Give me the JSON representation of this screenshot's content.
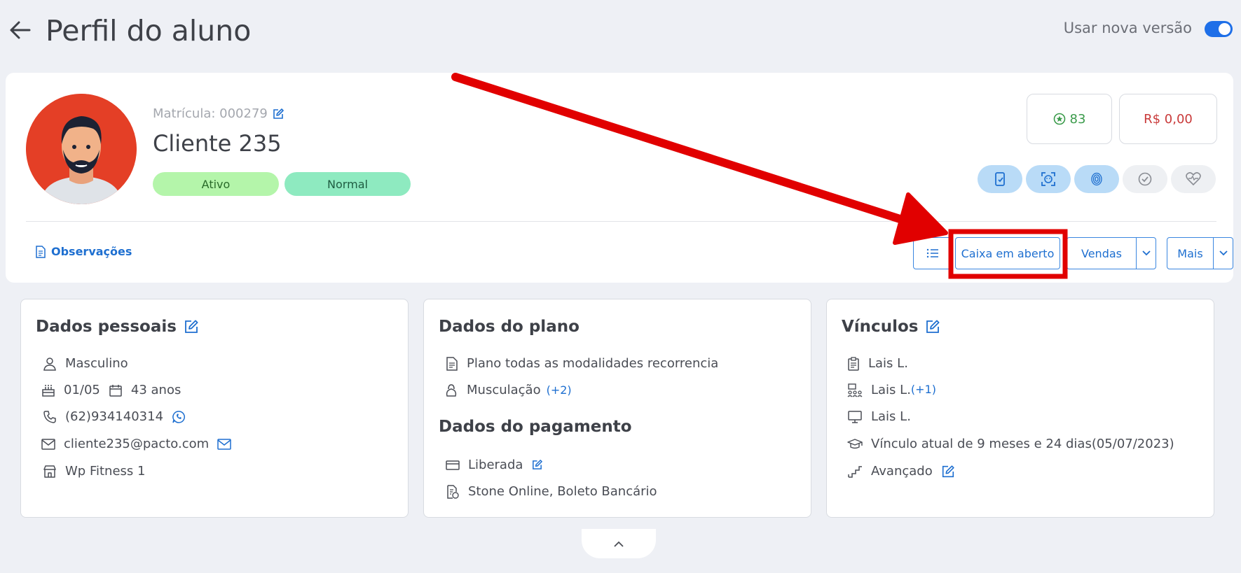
{
  "header": {
    "title": "Perfil do aluno",
    "toggle_label": "Usar nova versão",
    "toggle_on": true
  },
  "profile": {
    "matricula_label": "Matrícula: 000279",
    "name": "Cliente 235",
    "badges": [
      "Ativo",
      "Normal"
    ],
    "points": "83",
    "balance": "R$ 0,00"
  },
  "actions": {
    "observacoes": "Observações",
    "caixa": "Caixa em aberto",
    "vendas": "Vendas",
    "mais": "Mais"
  },
  "dados_pessoais": {
    "title": "Dados pessoais",
    "genero": "Masculino",
    "aniversario": "01/05",
    "idade": "43 anos",
    "telefone": "(62)934140314",
    "email": "cliente235@pacto.com",
    "unidade": "Wp Fitness 1"
  },
  "dados_plano": {
    "title": "Dados do plano",
    "plano": "Plano todas as modalidades recorrencia",
    "modalidade": "Musculação",
    "modalidade_extra": "(+2)"
  },
  "dados_pagamento": {
    "title": "Dados do pagamento",
    "status": "Liberada",
    "metodo": "Stone Online, Boleto Bancário"
  },
  "vinculos": {
    "title": "Vínculos",
    "consultor": "Lais L.",
    "professor": "Lais L.",
    "professor_extra": "(+1)",
    "terminal": "Lais L.",
    "vinculo_atual": "Vínculo atual de 9 meses e 24 dias(05/07/2023)",
    "nivel": "Avançado"
  },
  "colors": {
    "accent": "#1e6fd0",
    "annotation": "#e10000"
  }
}
